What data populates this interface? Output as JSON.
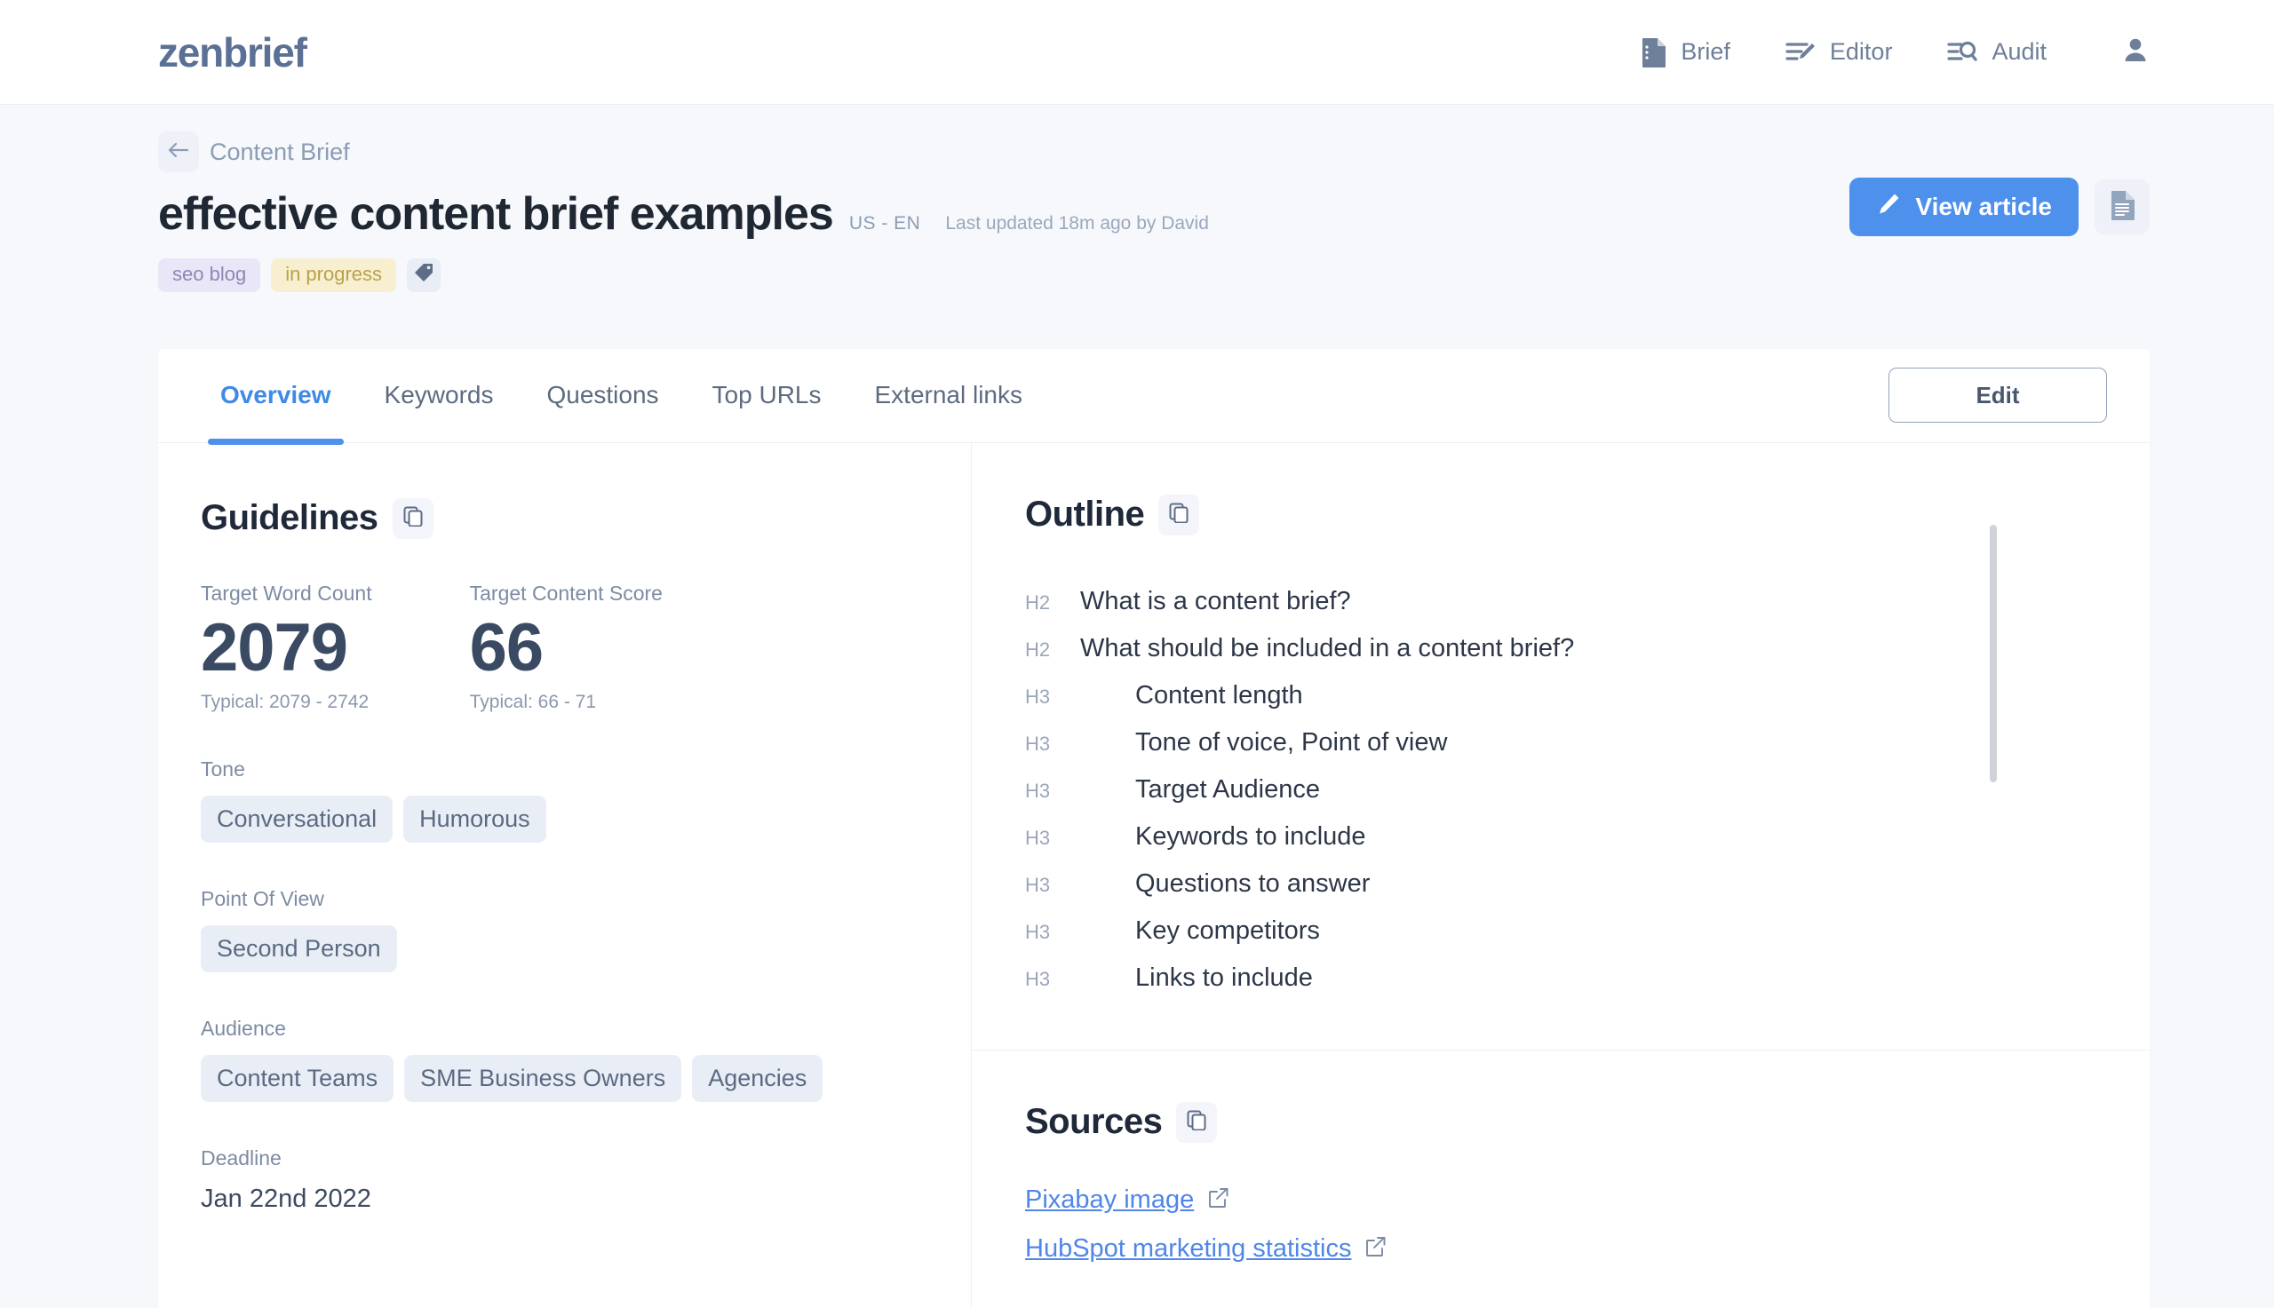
{
  "header": {
    "logo": "zenbrief",
    "nav": [
      {
        "label": "Brief",
        "icon": "document-icon"
      },
      {
        "label": "Editor",
        "icon": "edit-lines-icon"
      },
      {
        "label": "Audit",
        "icon": "search-lines-icon"
      }
    ],
    "account_icon": "person-icon"
  },
  "page": {
    "breadcrumb": "Content Brief",
    "back_icon": "arrow-left-icon",
    "title": "effective content brief examples",
    "locale": "US - EN",
    "updated": "Last updated 18m ago by David",
    "tags": [
      {
        "label": "seo blog",
        "style": "purple"
      },
      {
        "label": "in progress",
        "style": "yellow"
      }
    ],
    "tag_add_icon": "tag-icon",
    "primary_action": {
      "label": "View article",
      "icon": "pencil-icon"
    },
    "secondary_action_icon": "document-icon"
  },
  "tabs": [
    {
      "label": "Overview",
      "active": true
    },
    {
      "label": "Keywords",
      "active": false
    },
    {
      "label": "Questions",
      "active": false
    },
    {
      "label": "Top URLs",
      "active": false
    },
    {
      "label": "External links",
      "active": false
    }
  ],
  "edit_button": "Edit",
  "guidelines": {
    "title": "Guidelines",
    "copy_icon": "copy-icon",
    "metrics": [
      {
        "label": "Target Word Count",
        "value": "2079",
        "typical": "Typical: 2079 - 2742"
      },
      {
        "label": "Target Content Score",
        "value": "66",
        "typical": "Typical: 66 - 71"
      }
    ],
    "tone": {
      "label": "Tone",
      "values": [
        "Conversational",
        "Humorous"
      ]
    },
    "point_of_view": {
      "label": "Point Of View",
      "values": [
        "Second Person"
      ]
    },
    "audience": {
      "label": "Audience",
      "values": [
        "Content Teams",
        "SME Business Owners",
        "Agencies"
      ]
    },
    "deadline": {
      "label": "Deadline",
      "value": "Jan 22nd 2022"
    }
  },
  "outline": {
    "title": "Outline",
    "copy_icon": "copy-icon",
    "items": [
      {
        "level": "H2",
        "text": "What is a content brief?"
      },
      {
        "level": "H2",
        "text": "What should be included in a content brief?"
      },
      {
        "level": "H3",
        "text": "Content length"
      },
      {
        "level": "H3",
        "text": "Tone of voice, Point of view"
      },
      {
        "level": "H3",
        "text": "Target Audience"
      },
      {
        "level": "H3",
        "text": "Keywords to include"
      },
      {
        "level": "H3",
        "text": "Questions to answer"
      },
      {
        "level": "H3",
        "text": "Key competitors"
      },
      {
        "level": "H3",
        "text": "Links to include"
      }
    ]
  },
  "sources": {
    "title": "Sources",
    "copy_icon": "copy-icon",
    "links": [
      {
        "label": "Pixabay image",
        "icon": "external-link-icon"
      },
      {
        "label": "HubSpot marketing statistics",
        "icon": "external-link-icon"
      }
    ]
  },
  "colors": {
    "accent": "#4d91ec",
    "logo": "#5a7095",
    "page_bg": "#f6f8fb",
    "tag_purple_bg": "#e9e6f7",
    "tag_yellow_bg": "#f7efcf",
    "chip_bg": "#e9eef6"
  }
}
